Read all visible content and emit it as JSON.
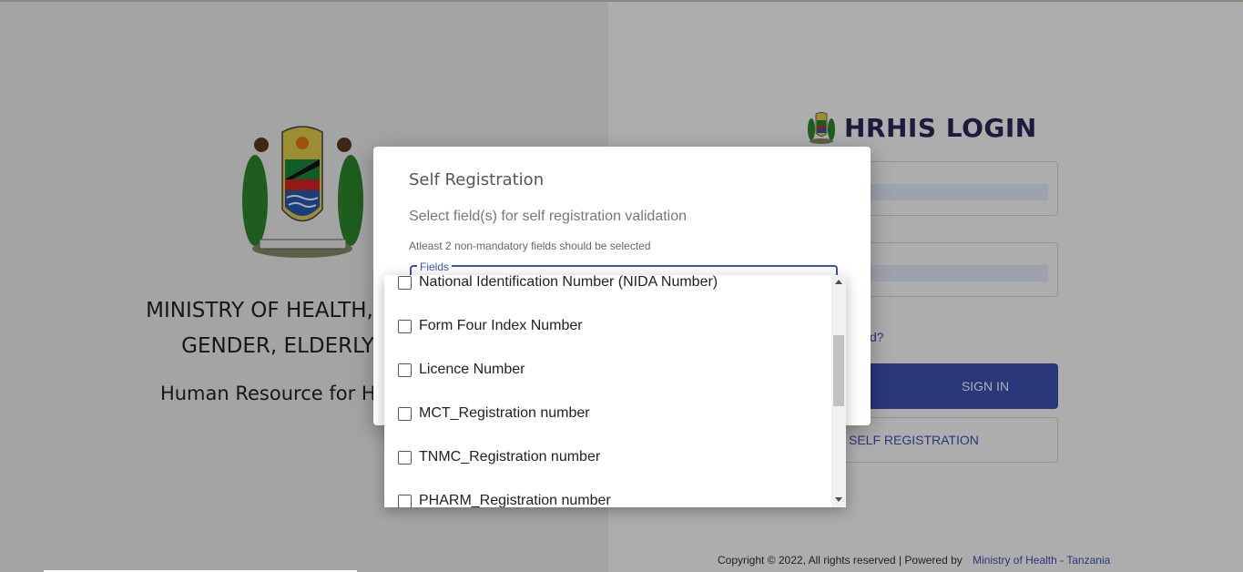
{
  "left": {
    "ministry_line1": "MINISTRY OF HEALTH, COMMU",
    "ministry_line2": "GENDER, ELDERLY AND",
    "system_name": "Human Resource for Health In",
    "emblem_icon": "tanzania-coat-of-arms"
  },
  "login": {
    "title": "HRHIS LOGIN",
    "forgot_text": "d?",
    "signin_label": "SIGN IN",
    "self_registration_label": "SELF REGISTRATION"
  },
  "footer": {
    "text": "Copyright © 2022, All rights reserved | Powered by",
    "link": "Ministry of Health - Tanzania"
  },
  "dialog": {
    "title": "Self Registration",
    "subtitle": "Select field(s) for self registration validation",
    "hint": "Atleast 2 non-mandatory fields should be selected",
    "fields_label": "Fields",
    "options": [
      {
        "label": "National Identification Number (NIDA Number)",
        "checked": false
      },
      {
        "label": "Form Four Index Number",
        "checked": false
      },
      {
        "label": "Licence Number",
        "checked": false
      },
      {
        "label": "MCT_Registration number",
        "checked": false
      },
      {
        "label": "TNMC_Registration number",
        "checked": false
      },
      {
        "label": "PHARM_Registration number",
        "checked": false
      }
    ]
  },
  "colors": {
    "primary": "#3f51b5",
    "title_navy": "#28285a",
    "overlay": "rgba(0,0,0,0.32)"
  }
}
